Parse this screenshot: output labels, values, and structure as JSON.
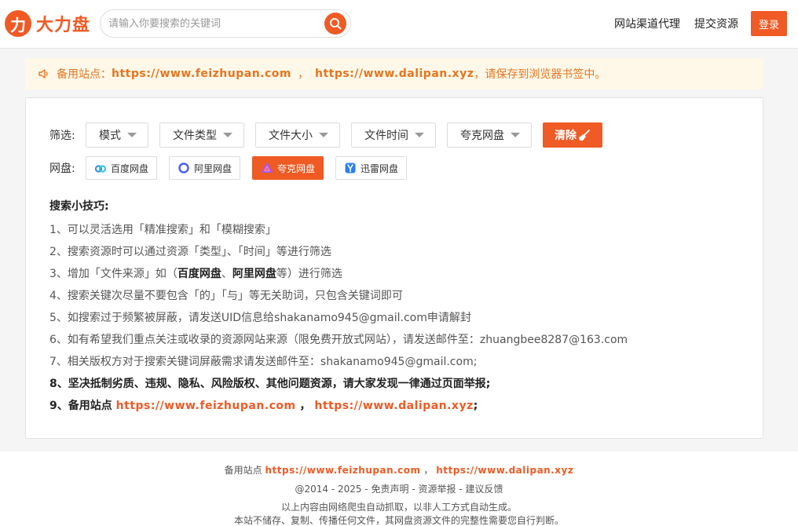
{
  "header": {
    "logo_mark": "力",
    "logo_text": "大力盘",
    "search_placeholder": "请输入你要搜索的关键词",
    "nav": [
      "网站渠道代理",
      "提交资源"
    ],
    "login_label": "登录"
  },
  "notice": {
    "prefix": "备用站点：",
    "url1": "https://www.feizhupan.com",
    "sep": "，",
    "url2": "https://www.dalipan.xyz",
    "suffix": "，请保存到浏览器书签中。"
  },
  "filters": {
    "label": "筛选:",
    "dropdowns": [
      "模式",
      "文件类型",
      "文件大小",
      "文件时间",
      "夸克网盘"
    ],
    "clear_label": "清除"
  },
  "disks": {
    "label": "网盘:",
    "items": [
      {
        "label": "百度网盘",
        "icon": "baidu-cloud-icon",
        "active": false
      },
      {
        "label": "阿里网盘",
        "icon": "aliyun-drive-icon",
        "active": false
      },
      {
        "label": "夸克网盘",
        "icon": "quark-drive-icon",
        "active": true
      },
      {
        "label": "迅雷网盘",
        "icon": "xunlei-drive-icon",
        "active": false
      }
    ]
  },
  "tips": {
    "title": "搜索小技巧:",
    "t1": "1、可以灵活选用「精准搜索」和「模糊搜索」",
    "t2": "2、搜索资源时可以通过资源「类型」、「时间」等进行筛选",
    "t3_pre": "3、增加「文件来源」如（",
    "t3_b1": "百度网盘",
    "t3_mid": "、",
    "t3_b2": "阿里网盘",
    "t3_post": "等）进行筛选",
    "t4": "4、搜索关键次尽量不要包含「的」「与」等无关助词，只包含关键词即可",
    "t5": "5、如搜索过于频繁被屏蔽，请发送UID信息给shakanamo945@gmail.com申请解封",
    "t6": "6、如有希望我们重点关注或收录的资源网站来源（限免费开放式网站），请发送邮件至：zhuangbee8287@163.com",
    "t7": "7、相关版权方对于搜索关键词屏蔽需求请发送邮件至：shakanamo945@gmail.com;",
    "t8": "8、坚决抵制劣质、违规、隐私、风险版权、其他问题资源，请大家发现一律通过页面举报;",
    "t9_pre": "9、备用站点 ",
    "t9_url1": "https://www.feizhupan.com",
    "t9_sep": " ， ",
    "t9_url2": "https://www.dalipan.xyz",
    "t9_post": ";"
  },
  "footer": {
    "backup_label": "备用站点",
    "url1": "https://www.feizhupan.com",
    "sep": "，",
    "url2": "https://www.dalipan.xyz",
    "copyright": "@2014 - 2025 - ",
    "disclaimer": "免责声明",
    "dash1": " - ",
    "report": "资源举报",
    "dash2": " - ",
    "feedback": "建议反馈",
    "note1": "以上内容由网络爬虫自动抓取，以非人工方式自动生成。",
    "note2": "本站不储存、复制、传播任何文件，其网盘资源文件的完整性需要您自行判断。"
  },
  "colors": {
    "accent": "#f05a24",
    "notice_bg": "#fff8e8"
  }
}
